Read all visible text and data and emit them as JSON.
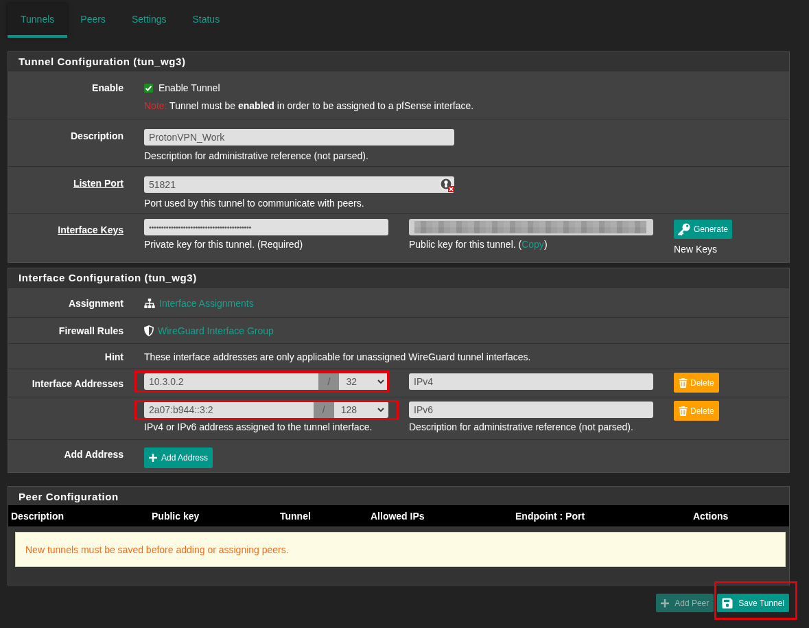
{
  "tabs": [
    {
      "label": "Tunnels",
      "selected": true
    },
    {
      "label": "Peers",
      "selected": false
    },
    {
      "label": "Settings",
      "selected": false
    },
    {
      "label": "Status",
      "selected": false
    }
  ],
  "tunnel_panel": {
    "title": "Tunnel Configuration (tun_wg3)",
    "rows": [
      {
        "kind": "checkbox",
        "label": "Enable",
        "label_link": false,
        "checkbox_label": "Enable Tunnel",
        "checked": true,
        "note_prefix": "Note:",
        "note": "Tunnel must be **enabled** in order to be assigned to a pfSense interface."
      },
      {
        "kind": "text",
        "label": "Description",
        "label_link": false,
        "value": "ProtonVPN_Work",
        "extension_badge": false,
        "help": "Description for administrative reference (not parsed)."
      },
      {
        "kind": "text",
        "label": "Listen Port",
        "label_link": true,
        "value": "51821",
        "extension_badge": true,
        "help": "Port used by this tunnel to communicate with peers."
      },
      {
        "kind": "keys",
        "label": "Interface Keys",
        "label_link": true,
        "private_key": "••••••••••••••••••••••••••••••••••••••••••",
        "private_help": "Private key for this tunnel. (Required)",
        "public_key_redacted": true,
        "public_help": "Public key for this tunnel. (",
        "public_help_link": "Copy",
        "public_help_end": ")",
        "button": "Generate",
        "button_note": "New Keys"
      }
    ]
  },
  "interface_panel": {
    "title": "Interface Configuration (tun_wg3)",
    "rows": [
      {
        "kind": "link",
        "label": "Assignment",
        "link": "Interface Assignments"
      },
      {
        "kind": "link",
        "label": "Firewall Rules",
        "link": "WireGuard Interface Group"
      },
      {
        "kind": "hint",
        "label": "Hint",
        "text": "These interface addresses are only applicable for unassigned WireGuard tunnel interfaces."
      },
      {
        "kind": "addresses",
        "label": "Interface Addresses",
        "entries": [
          {
            "address": "10.3.0.2",
            "separator": "/",
            "mask": "32",
            "description": "IPv4",
            "button": "Delete",
            "highlighted": true
          },
          {
            "address": "2a07:b944::3:2",
            "separator": "/",
            "mask": "128",
            "description": "IPv6",
            "button": "Delete",
            "highlighted": true
          }
        ],
        "address_help": "IPv4 or IPv6 address assigned to the tunnel interface.",
        "description_help": "Description for administrative reference (not parsed)."
      },
      {
        "kind": "button",
        "label": "Add Address",
        "button": "Add Address"
      }
    ]
  },
  "peer_panel": {
    "title": "Peer Configuration",
    "columns": [
      "Description",
      "Public key",
      "Tunnel",
      "Allowed IPs",
      "Endpoint : Port",
      "Actions"
    ],
    "notice": "New tunnels must be saved before adding or assigning peers."
  },
  "actions": [
    {
      "kind": "add",
      "label": "Add Peer",
      "disabled": true,
      "highlighted": false
    },
    {
      "kind": "save",
      "label": "Save Tunnel",
      "disabled": false,
      "highlighted": true
    }
  ]
}
